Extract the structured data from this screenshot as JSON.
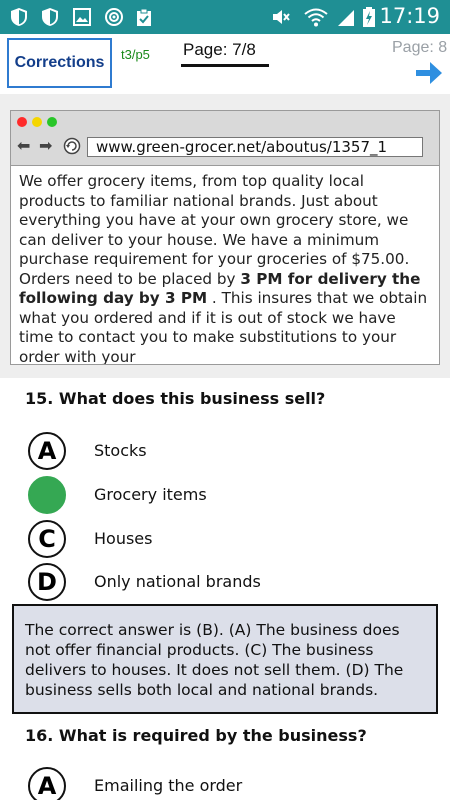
{
  "status_bar": {
    "time": "17:19",
    "left_icons": [
      "shield-icon",
      "shield-icon",
      "image-icon",
      "sync-icon",
      "clipboard-icon"
    ],
    "right_icons": [
      "mute-icon",
      "wifi-icon",
      "signal-icon",
      "battery-charging-icon"
    ]
  },
  "toolbar": {
    "corrections_label": "Corrections",
    "section_label": "t3/p5",
    "page_indicator": "Page: 7/8",
    "next_page_label": "Page: 8",
    "next_icon": "arrow-right-icon"
  },
  "browser": {
    "url": "www.green-grocer.net/aboutus/1357_1",
    "text_part1": "We offer grocery items, from top quality local products to familiar national brands. Just about everything you have at your own grocery store, we can deliver to your house. We have a minimum purchase requirement for your groceries of $75.00.  Orders need to be placed by ",
    "text_bold": "3 PM for delivery the following day by 3 PM",
    "text_part2": " . This insures that we obtain what you ordered and if it is out of stock we have time to contact you to make substitutions to your order with your"
  },
  "questions": [
    {
      "title": "15. What does this business sell?",
      "options": [
        {
          "letter": "A",
          "text": "Stocks",
          "selected": false
        },
        {
          "letter": "B",
          "text": "Grocery items",
          "selected": true
        },
        {
          "letter": "C",
          "text": "Houses",
          "selected": false
        },
        {
          "letter": "D",
          "text": "Only national brands",
          "selected": false
        }
      ],
      "explanation": "The correct answer is (B). (A) The business does not offer financial products. (C) The business delivers to houses. It does not sell them. (D) The business sells both local and national brands."
    },
    {
      "title": "16. What is required by the business?",
      "options": [
        {
          "letter": "A",
          "text": "Emailing the order",
          "selected": false
        }
      ]
    }
  ],
  "colors": {
    "status_bar": "#1f8f94",
    "selected_answer": "#35a853",
    "section_label": "#1a8a1a",
    "arrow": "#2f8fe0",
    "explanation_bg": "#dcdfe9"
  }
}
